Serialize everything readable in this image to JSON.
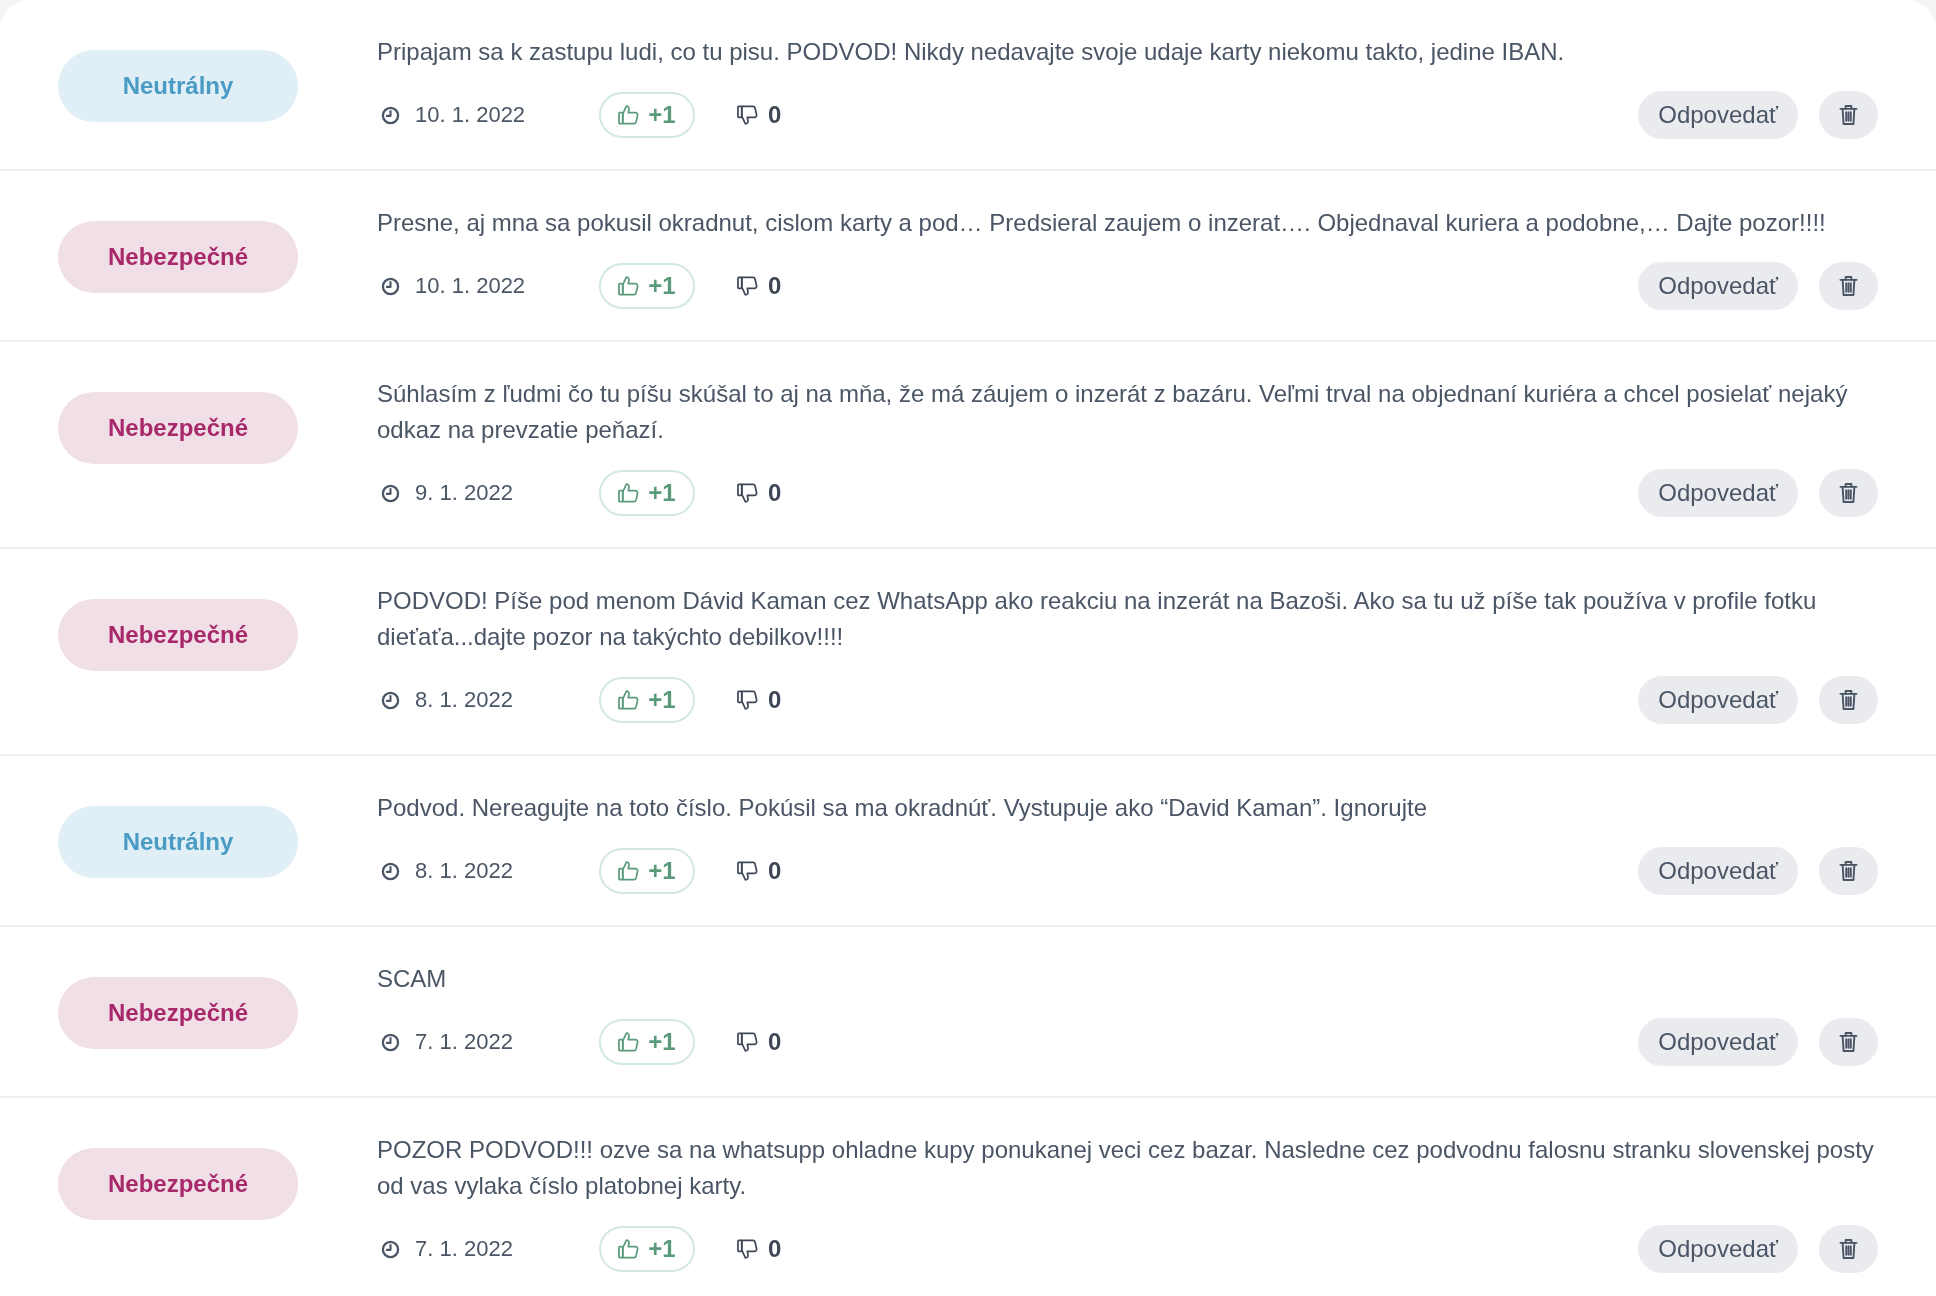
{
  "comments": [
    {
      "rating": {
        "kind": "neutral",
        "label": "Neutrálny"
      },
      "text": "Pripajam sa k zastupu ludi, co tu pisu. PODVOD! Nikdy nedavajte svoje udaje karty niekomu takto, jedine IBAN.",
      "date": "10. 1. 2022",
      "likes": "+1",
      "dislikes": "0",
      "reply_button": "Odpovedať"
    },
    {
      "rating": {
        "kind": "dangerous",
        "label": "Nebezpečné"
      },
      "text": "Presne, aj mna sa pokusil okradnut, cislom karty a pod… Predsieral zaujem o inzerat…. Objednaval kuriera a podobne,… Dajte pozor!!!!",
      "date": "10. 1. 2022",
      "likes": "+1",
      "dislikes": "0",
      "reply_button": "Odpovedať"
    },
    {
      "rating": {
        "kind": "dangerous",
        "label": "Nebezpečné"
      },
      "text": "Súhlasím z ľudmi čo tu píšu skúšal to aj na mňa, že má záujem o inzerát z bazáru. Veľmi trval na objednaní kuriéra a chcel posielať nejaký odkaz na prevzatie peňazí.",
      "date": "9. 1. 2022",
      "likes": "+1",
      "dislikes": "0",
      "reply_button": "Odpovedať"
    },
    {
      "rating": {
        "kind": "dangerous",
        "label": "Nebezpečné"
      },
      "text": "PODVOD! Píše pod menom Dávid Kaman cez WhatsApp ako reakciu na inzerát na Bazoši. Ako sa tu už píše tak používa v profile fotku dieťaťa...dajte pozor na takýchto debilkov!!!!",
      "date": "8. 1. 2022",
      "likes": "+1",
      "dislikes": "0",
      "reply_button": "Odpovedať"
    },
    {
      "rating": {
        "kind": "neutral",
        "label": "Neutrálny"
      },
      "text": "Podvod. Nereagujte na toto číslo. Pokúsil sa ma okradnúť. Vystupuje ako “David Kaman”. Ignorujte",
      "date": "8. 1. 2022",
      "likes": "+1",
      "dislikes": "0",
      "reply_button": "Odpovedať"
    },
    {
      "rating": {
        "kind": "dangerous",
        "label": "Nebezpečné"
      },
      "text": "SCAM",
      "date": "7. 1. 2022",
      "likes": "+1",
      "dislikes": "0",
      "reply_button": "Odpovedať"
    },
    {
      "rating": {
        "kind": "dangerous",
        "label": "Nebezpečné"
      },
      "text": "POZOR PODVOD!!! ozve sa na whatsupp ohladne kupy ponukanej veci cez bazar. Nasledne cez podvodnu falosnu stranku slovenskej posty od vas vylaka číslo platobnej karty.",
      "date": "7. 1. 2022",
      "likes": "+1",
      "dislikes": "0",
      "reply_button": "Odpovedať"
    }
  ]
}
